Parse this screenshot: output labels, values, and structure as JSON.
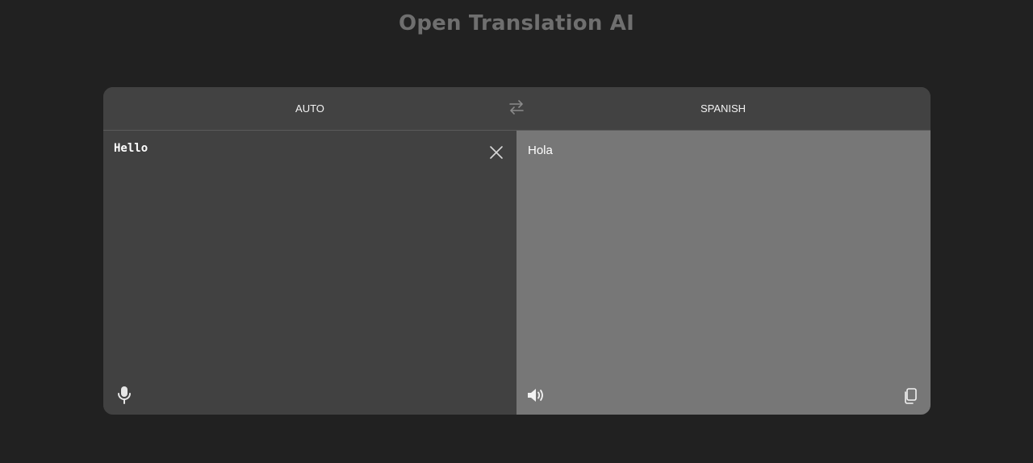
{
  "app": {
    "title": "Open Translation AI"
  },
  "languages": {
    "source": "AUTO",
    "target": "SPANISH"
  },
  "input": {
    "value": "Hello",
    "placeholder": ""
  },
  "output": {
    "text": "Hola"
  },
  "icons": {
    "swap": "swap-arrows-icon",
    "clear": "close-icon",
    "mic": "microphone-icon",
    "speaker": "speaker-icon",
    "copy": "copy-icon"
  },
  "colors": {
    "background": "#212121",
    "title": "#6f6f6f",
    "source_pane": "#414141",
    "target_pane": "#777777",
    "text": "#ffffff"
  }
}
